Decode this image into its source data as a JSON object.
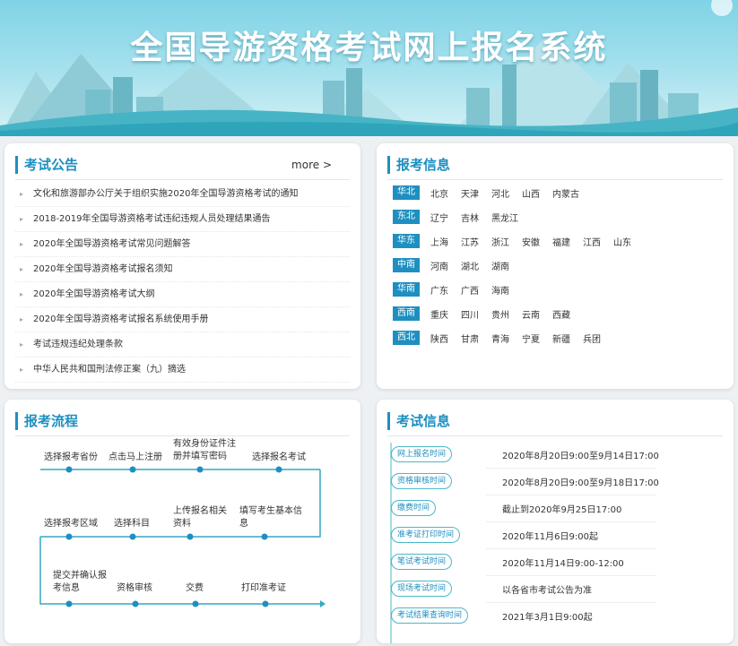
{
  "banner": {
    "title": "全国导游资格考试网上报名系统"
  },
  "notice": {
    "title": "考试公告",
    "more_label": "more >",
    "items": [
      "文化和旅游部办公厅关于组织实施2020年全国导游资格考试的通知",
      "2018-2019年全国导游资格考试违纪违规人员处理结果通告",
      "2020年全国导游资格考试常见问题解答",
      "2020年全国导游资格考试报名须知",
      "2020年全国导游资格考试大纲",
      "2020年全国导游资格考试报名系统使用手册",
      "考试违规违纪处理条款",
      "中华人民共和国刑法修正案（九）摘选"
    ]
  },
  "info": {
    "title": "报考信息",
    "regions": [
      {
        "name": "华北",
        "provinces": [
          "北京",
          "天津",
          "河北",
          "山西",
          "内蒙古"
        ]
      },
      {
        "name": "东北",
        "provinces": [
          "辽宁",
          "吉林",
          "黑龙江"
        ]
      },
      {
        "name": "华东",
        "provinces": [
          "上海",
          "江苏",
          "浙江",
          "安徽",
          "福建",
          "江西",
          "山东"
        ]
      },
      {
        "name": "中南",
        "provinces": [
          "河南",
          "湖北",
          "湖南"
        ]
      },
      {
        "name": "华南",
        "provinces": [
          "广东",
          "广西",
          "海南"
        ]
      },
      {
        "name": "西南",
        "provinces": [
          "重庆",
          "四川",
          "贵州",
          "云南",
          "西藏"
        ]
      },
      {
        "name": "西北",
        "provinces": [
          "陕西",
          "甘肃",
          "青海",
          "宁夏",
          "新疆",
          "兵团"
        ]
      }
    ]
  },
  "flow": {
    "title": "报考流程",
    "row1": [
      "选择报考省份",
      "点击马上注册",
      "有效身份证件注册并填写密码",
      "选择报名考试"
    ],
    "row2": [
      "选择报考区域",
      "选择科目",
      "上传报名相关资料",
      "填写考生基本信息"
    ],
    "row3": [
      "提交并确认报考信息",
      "资格审核",
      "交费",
      "打印准考证"
    ]
  },
  "exam": {
    "title": "考试信息",
    "rows": [
      {
        "label": "网上报名时间",
        "value": "2020年8月20日9:00至9月14日17:00"
      },
      {
        "label": "资格审核时间",
        "value": "2020年8月20日9:00至9月18日17:00"
      },
      {
        "label": "缴费时间",
        "value": "截止到2020年9月25日17:00"
      },
      {
        "label": "准考证打印时间",
        "value": "2020年11月6日9:00起"
      },
      {
        "label": "笔试考试时间",
        "value": "2020年11月14日9:00-12:00"
      },
      {
        "label": "现场考试时间",
        "value": "以各省市考试公告为准"
      },
      {
        "label": "考试结果查询时间",
        "value": "2021年3月1日9:00起"
      }
    ]
  },
  "colors": {
    "accent": "#1e8fc0",
    "flow_line": "#36a7c2",
    "tag_bg": "#1e8fc0"
  }
}
